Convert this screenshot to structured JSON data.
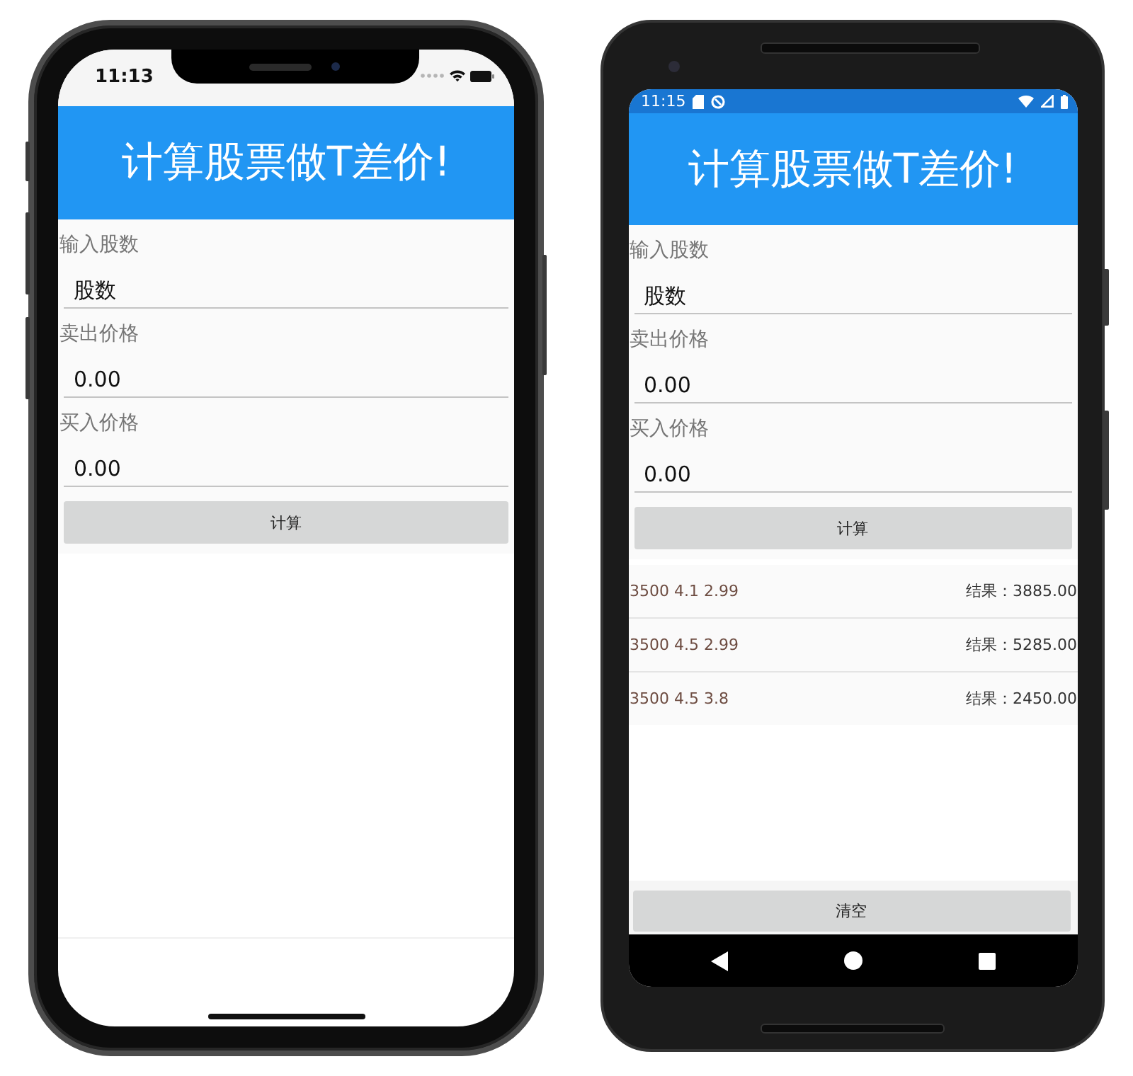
{
  "phones": [
    {
      "kind": "iphone",
      "status_bar": {
        "time": "11:13"
      },
      "header": {
        "title": "计算股票做T差价!"
      },
      "fields": [
        {
          "label": "输入股数",
          "value": "股数"
        },
        {
          "label": "卖出价格",
          "value": "0.00"
        },
        {
          "label": "买入价格",
          "value": "0.00"
        }
      ],
      "calculate_button": "计算"
    },
    {
      "kind": "android",
      "status_bar": {
        "time": "11:15"
      },
      "header": {
        "title": "计算股票做T差价!"
      },
      "fields": [
        {
          "label": "输入股数",
          "value": "股数"
        },
        {
          "label": "卖出价格",
          "value": "0.00"
        },
        {
          "label": "买入价格",
          "value": "0.00"
        }
      ],
      "calculate_button": "计算",
      "results": [
        {
          "inputs": "3500 4.1 2.99",
          "result": "结果：3885.00"
        },
        {
          "inputs": "3500 4.5 2.99",
          "result": "结果：5285.00"
        },
        {
          "inputs": "3500 4.5 3.8",
          "result": "结果：2450.00"
        }
      ],
      "clear_button": "清空"
    }
  ]
}
